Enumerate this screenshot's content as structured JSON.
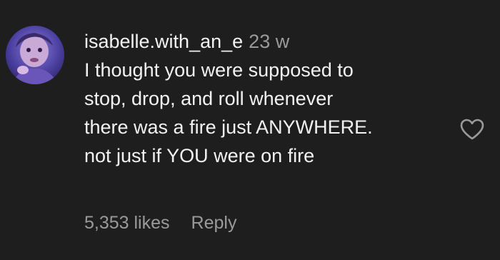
{
  "comment": {
    "username": "isabelle.with_an_e",
    "time": "23 w",
    "lines": [
      "I thought you were supposed to",
      "stop, drop, and roll whenever",
      "there was a fire just ANYWHERE.",
      "not just if YOU were on fire"
    ],
    "likes": "5,353 likes",
    "reply_label": "Reply"
  },
  "icons": {
    "like": "heart-outline-icon"
  },
  "colors": {
    "background": "#1e1e1e",
    "primary_text": "#f2f2f2",
    "secondary_text": "#9a9a9a"
  }
}
